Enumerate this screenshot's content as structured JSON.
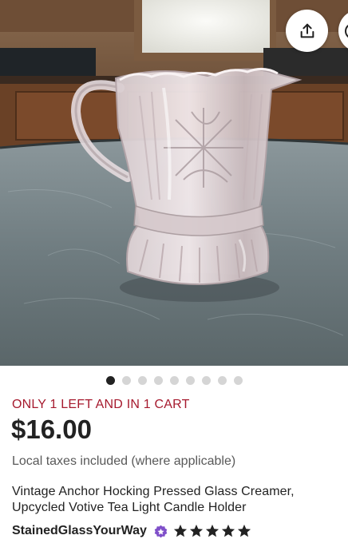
{
  "listing": {
    "stock_notice": "ONLY 1 LEFT AND IN 1 CART",
    "price": "$16.00",
    "tax_note": "Local taxes included (where applicable)",
    "title": "Vintage Anchor Hocking Pressed Glass Creamer, Upcycled Votive Tea Light Candle Holder",
    "shop_name": "StainedGlassYourWay",
    "rating_stars": 5
  },
  "carousel": {
    "total_images": 9,
    "active_index": 0
  },
  "icons": {
    "share": "share-icon",
    "favorite": "heart-icon",
    "badge": "star-seller-badge-icon",
    "star": "star-icon"
  },
  "colors": {
    "stock_notice": "#a61a2e",
    "badge": "#7f4fc9",
    "dot_active": "#222222",
    "dot_inactive": "#d5d5d5"
  }
}
